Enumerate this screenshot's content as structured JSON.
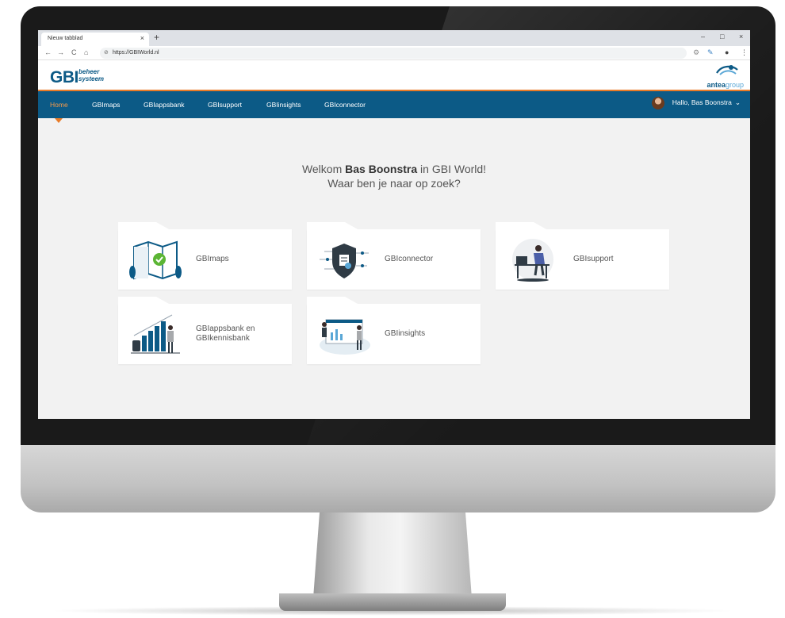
{
  "browser": {
    "tab_title": "Nieuw tabblad",
    "tab_close": "×",
    "new_tab": "+",
    "url": "https://GBIWorld.nl",
    "nav": {
      "back": "←",
      "forward": "→",
      "reload": "C",
      "home": "⌂"
    },
    "window": {
      "minimize": "–",
      "restore": "□",
      "close": "×"
    }
  },
  "app": {
    "logo_main": "GBI",
    "logo_sub1": "beheer",
    "logo_sub2": "systeem",
    "partner_logo_a": "antea",
    "partner_logo_b": "group"
  },
  "nav": {
    "items": [
      {
        "label": "Home",
        "active": true
      },
      {
        "label": "GBImaps"
      },
      {
        "label": "GBIappsbank"
      },
      {
        "label": "GBIsupport"
      },
      {
        "label": "GBIinsights"
      },
      {
        "label": "GBIconnector"
      }
    ],
    "user_greeting": "Hallo, Bas Boonstra",
    "user_chevron": "⌄"
  },
  "welcome": {
    "pre": "Welkom ",
    "name": "Bas Boonstra",
    "post": " in GBI World!",
    "line2": "Waar ben je naar op zoek?"
  },
  "cards": [
    {
      "label": "GBImaps",
      "icon": "map-check-icon"
    },
    {
      "label": "GBIconnector",
      "icon": "shield-connector-icon"
    },
    {
      "label": "GBIsupport",
      "icon": "support-desk-icon"
    },
    {
      "label1": "GBIappsbank en",
      "label2": "GBIkennisbank",
      "icon": "bar-growth-icon"
    },
    {
      "label": "GBIinsights",
      "icon": "insights-board-icon"
    }
  ],
  "colors": {
    "brand": "#0c5a86",
    "accent": "#e97b27",
    "check": "#5bb534"
  }
}
